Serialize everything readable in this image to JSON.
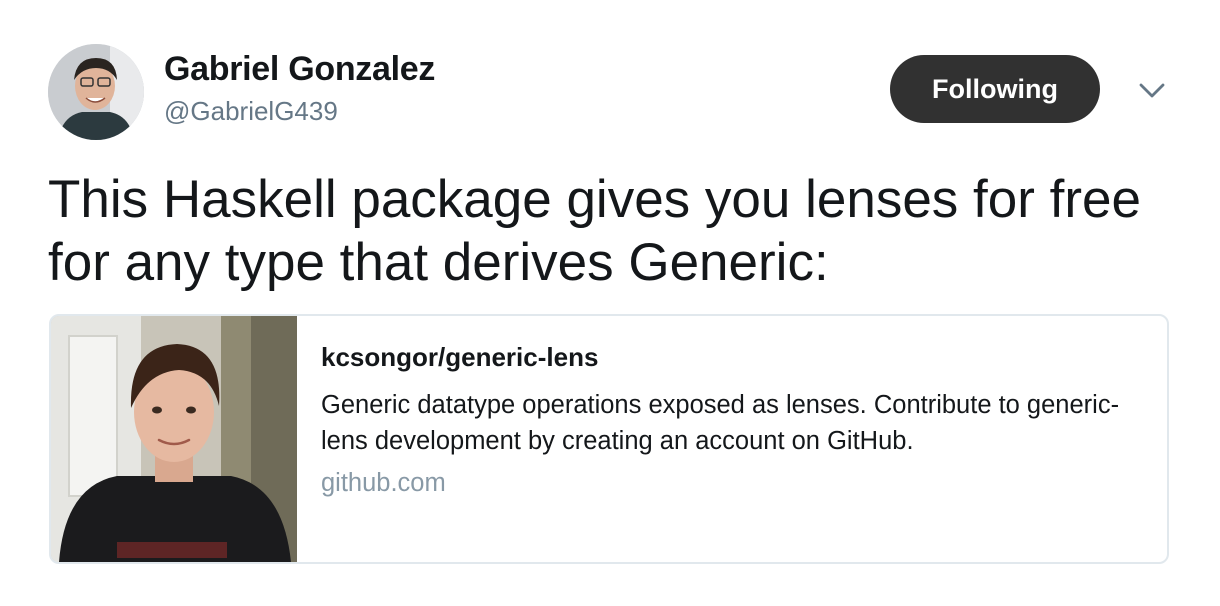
{
  "author": {
    "name": "Gabriel Gonzalez",
    "handle": "@GabrielG439",
    "avatar_icon": "profile-photo-icon"
  },
  "follow_button": {
    "label": "Following"
  },
  "menu": {
    "icon": "chevron-down-icon"
  },
  "tweet": {
    "text": "This Haskell package gives you lenses for free for any type that derives Generic:"
  },
  "card": {
    "title": "kcsongor/generic-lens",
    "description": "Generic datatype operations exposed as lenses. Contribute to generic-lens development by creating an account on GitHub.",
    "domain": "github.com",
    "image_icon": "profile-photo-icon"
  },
  "colors": {
    "text_primary": "#14171a",
    "text_secondary": "#657786",
    "domain_gray": "#8899a6",
    "button_bg": "#313131",
    "card_border": "#e1e8ed"
  }
}
